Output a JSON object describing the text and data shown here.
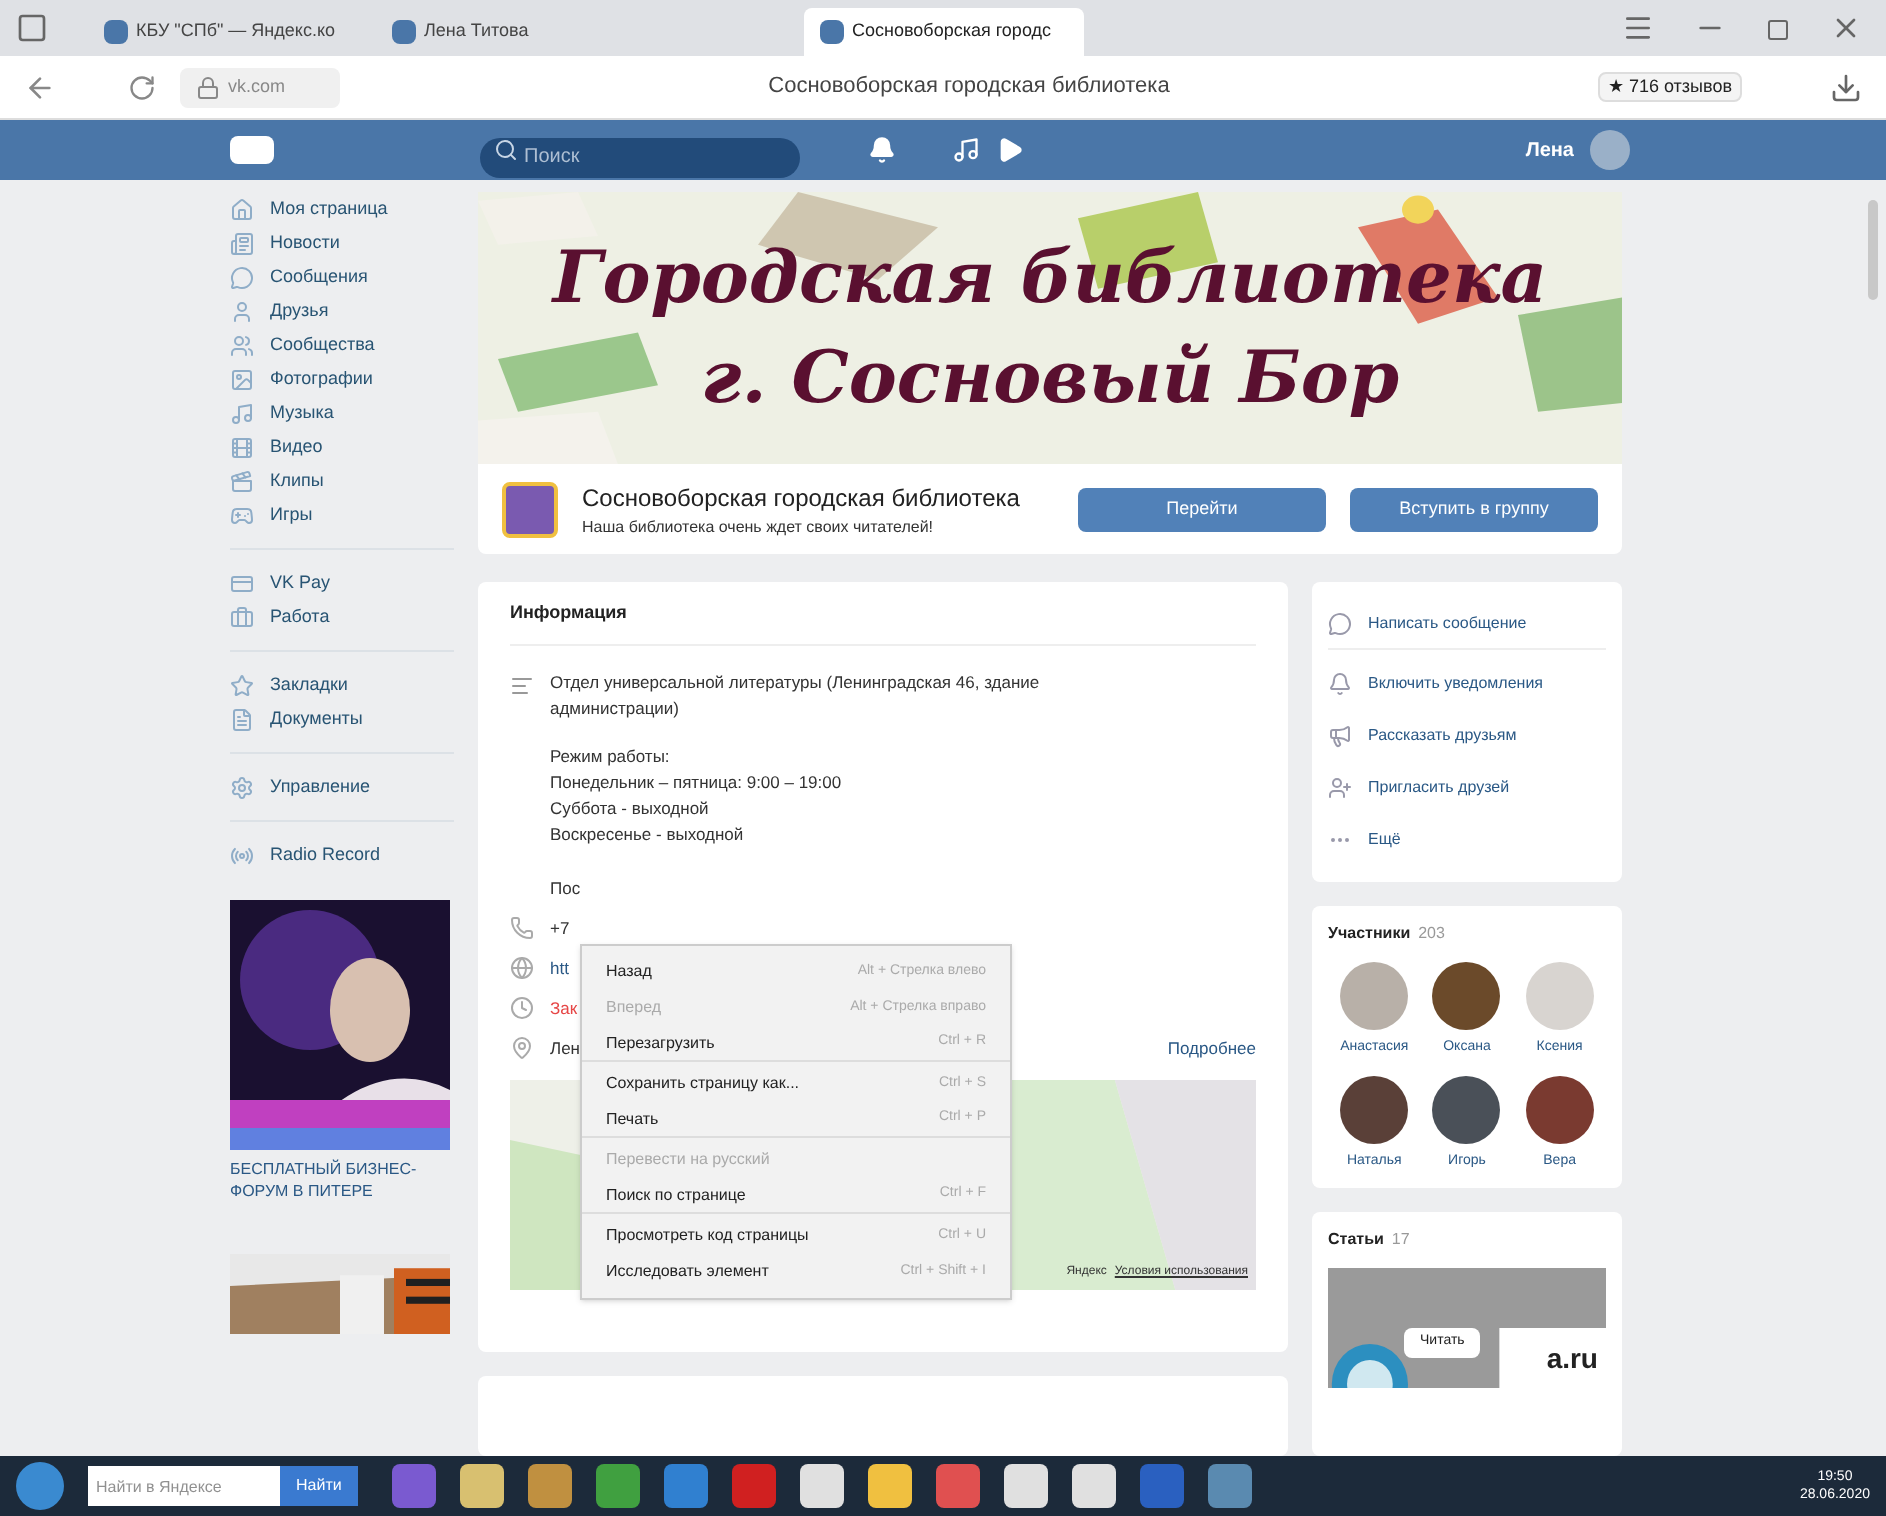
{
  "browser": {
    "tabs": [
      {
        "label": "КБУ \"СПб\" — Яндекс.ко",
        "selected": false
      },
      {
        "label": "Лена Титова",
        "selected": false
      },
      {
        "label": "Сосновоборская городс",
        "selected": true
      }
    ],
    "address": "vk.com",
    "page_title": "Сосновоборская городская библиотека",
    "reviews": "★ 716 отзывов"
  },
  "vk_header": {
    "search_placeholder": "Поиск",
    "user_name": "Лена"
  },
  "sidebar": {
    "groups": [
      [
        "Моя страница",
        "Новости",
        "Сообщения",
        "Друзья",
        "Сообщества",
        "Фотографии",
        "Музыка",
        "Видео",
        "Клипы",
        "Игры"
      ],
      [
        "VK Pay",
        "Работа"
      ],
      [
        "Закладки",
        "Документы"
      ],
      [
        "Управление"
      ],
      [
        "Radio Record"
      ]
    ],
    "ads": [
      {
        "title": "БЕСПЛАТНЫЙ БИЗНЕС-ФОРУМ В ПИТЕРЕ"
      },
      {
        "kind": "picture"
      }
    ]
  },
  "cover": {
    "lines": [
      "Городская библиотека",
      "г. Сосновый Бор"
    ]
  },
  "group": {
    "name": "Сосновоборская городская библиотека",
    "status": "Наша библиотека очень ждет своих читателей!",
    "buttons": [
      "Перейти",
      "Вступить в группу"
    ]
  },
  "info": {
    "title": "Информация",
    "description": "Отдел универсальной литературы (Ленинградская 46, здание администрации)",
    "hours": [
      "Режим работы:",
      "Понедельник – пятница: 9:00 – 19:00",
      "Суббота - выходной",
      "Воскресенье - выходной"
    ],
    "details": [
      {
        "kind": "text",
        "text": "Пос"
      },
      {
        "kind": "phone",
        "text": "+7"
      },
      {
        "kind": "site",
        "text": "htt"
      },
      {
        "kind": "closed",
        "text": "Зак"
      },
      {
        "kind": "place",
        "text": "Лен"
      }
    ],
    "more": "Подробнее",
    "map_credit": "Яндекс",
    "map_terms": "Условия использования"
  },
  "context_menu": [
    {
      "label": "Назад",
      "shortcut": "Alt + Стрелка влево",
      "disabled": false
    },
    {
      "label": "Вперед",
      "shortcut": "Alt + Стрелка вправо",
      "disabled": true
    },
    {
      "label": "Перезагрузить",
      "shortcut": "Ctrl + R",
      "disabled": false,
      "divider_after": true
    },
    {
      "label": "Сохранить страницу как...",
      "shortcut": "Ctrl + S",
      "disabled": false
    },
    {
      "label": "Печать",
      "shortcut": "Ctrl + P",
      "disabled": false,
      "divider_after": true
    },
    {
      "label": "Перевести на русский",
      "disabled": true
    },
    {
      "label": "Поиск по странице",
      "shortcut": "Ctrl + F",
      "disabled": false,
      "divider_after": true
    },
    {
      "label": "Просмотреть код страницы",
      "shortcut": "Ctrl + U",
      "disabled": false
    },
    {
      "label": "Исследовать элемент",
      "shortcut": "Ctrl + Shift + I",
      "disabled": false
    }
  ],
  "actions": [
    "Написать сообщение",
    "Включить уведомления",
    "Рассказать друзьям",
    "Пригласить друзей",
    "Ещё"
  ],
  "members": {
    "title": "Участники",
    "count": "203",
    "people": [
      {
        "name": "Анастасия",
        "color": "#b8b0a8"
      },
      {
        "name": "Оксана",
        "color": "#6b4a2a"
      },
      {
        "name": "Ксения",
        "color": "#d8d4d0"
      },
      {
        "name": "Наталья",
        "color": "#5a4038"
      },
      {
        "name": "Игорь",
        "color": "#4a5058"
      },
      {
        "name": "Вера",
        "color": "#7a3a30"
      }
    ]
  },
  "articles": {
    "title": "Статьи",
    "count": "17",
    "read_button": "Читать",
    "preview_text": "a.ru"
  },
  "taskbar": {
    "search_placeholder": "Найти в Яндексе",
    "search_button": "Найти",
    "time": "19:50",
    "date": "28.06.2020"
  }
}
